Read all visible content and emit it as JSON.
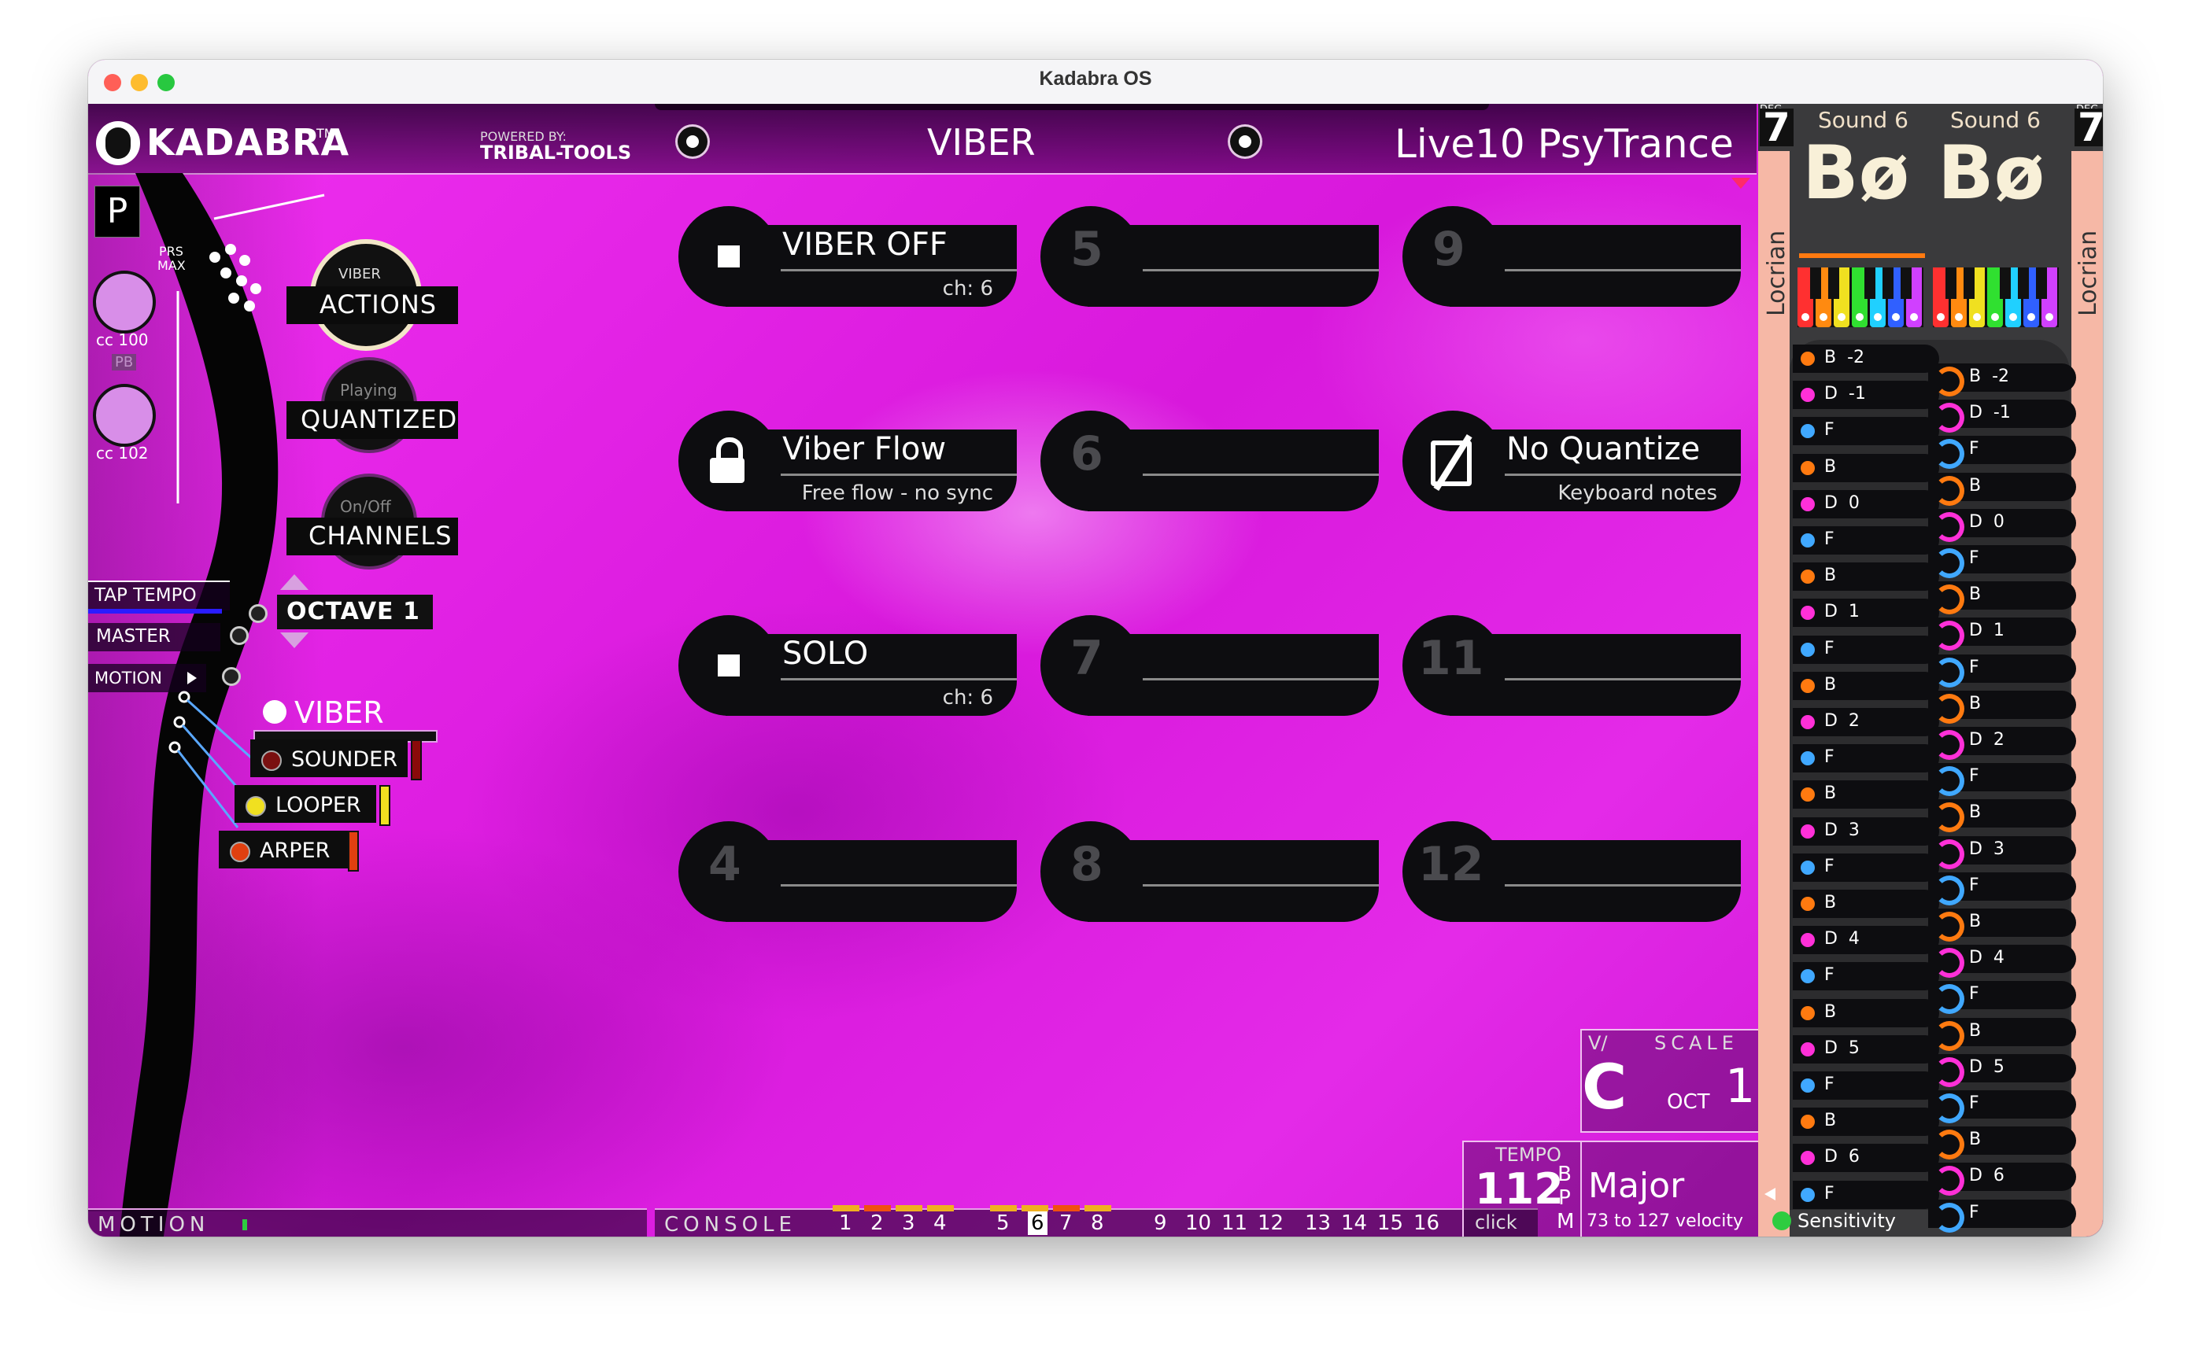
{
  "window": {
    "title": "Kadabra OS"
  },
  "header": {
    "logo": "KADABRA",
    "tm": "TM",
    "powered_by": "POWERED BY:",
    "powered_name": "TRIBAL-TOOLS",
    "mode": "VIBER",
    "preset": "Live10 PsyTrance"
  },
  "left": {
    "p_label": "P",
    "cc1": "cc 100",
    "cc2": "cc 102",
    "pb": "PB",
    "prs": "PRS",
    "max": "MAX",
    "round_buttons": [
      {
        "top": "VIBER",
        "main": "ACTIONS"
      },
      {
        "top": "Playing",
        "main": "QUANTIZED"
      },
      {
        "top": "On/Off",
        "main": "CHANNELS"
      }
    ],
    "tap_tempo": "TAP TEMPO",
    "master": "MASTER",
    "motion": "MOTION",
    "octave": "OCTAVE 1",
    "instrument": "VIBER",
    "instruments": [
      {
        "label": "SOUNDER",
        "color": "#8a0a0a"
      },
      {
        "label": "LOOPER",
        "color": "#f0e020"
      },
      {
        "label": "ARPER",
        "color": "#e04010"
      }
    ]
  },
  "grid": [
    {
      "num": "",
      "label": "VIBER OFF",
      "sub": "ch: 6",
      "icon": "stop"
    },
    {
      "num": "5",
      "label": "",
      "sub": ""
    },
    {
      "num": "9",
      "label": "",
      "sub": ""
    },
    {
      "num": "",
      "label": "Viber Flow",
      "sub": "Free flow - no sync",
      "icon": "unlock"
    },
    {
      "num": "6",
      "label": "",
      "sub": ""
    },
    {
      "num": "",
      "label": "No Quantize",
      "sub": "Keyboard notes",
      "icon": "no-quantize"
    },
    {
      "num": "",
      "label": "SOLO",
      "sub": "ch: 6",
      "icon": "stop"
    },
    {
      "num": "7",
      "label": "",
      "sub": ""
    },
    {
      "num": "11",
      "label": "",
      "sub": ""
    },
    {
      "num": "4",
      "label": "",
      "sub": ""
    },
    {
      "num": "8",
      "label": "",
      "sub": ""
    },
    {
      "num": "12",
      "label": "",
      "sub": ""
    }
  ],
  "bottom": {
    "motion": "MOTION",
    "console": "CONSOLE",
    "channels": [
      "1",
      "2",
      "3",
      "4",
      "5",
      "6",
      "7",
      "8",
      "9",
      "10",
      "11",
      "12",
      "13",
      "14",
      "15",
      "16"
    ],
    "active_channel": "6"
  },
  "scale": {
    "v": "V/",
    "title": "SCALE",
    "key": "C",
    "oct_label": "OCT",
    "oct": "1",
    "tempo_label": "TEMPO",
    "bpm": "112",
    "bpm_unit": "BPM",
    "click": "click",
    "mode": "Major",
    "velocity": "73 to 127 velocity"
  },
  "right": {
    "deg_label": "DEG",
    "deg": "7",
    "mode_name": "Locrian",
    "sound_label": "Sound 6",
    "chord": "Bø",
    "sensitivity": "Sensitivity",
    "col1": [
      "B  -2",
      "D  -1",
      "F",
      "B",
      "D  0",
      "F",
      "B",
      "D  1",
      "F",
      "B",
      "D  2",
      "F",
      "B",
      "D  3",
      "F",
      "B",
      "D  4",
      "F",
      "B",
      "D  5",
      "F",
      "B",
      "D  6",
      "F"
    ],
    "col2": [
      "B  -2",
      "D  -1",
      "F",
      "B",
      "D  0",
      "F",
      "B",
      "D  1",
      "F",
      "B",
      "D  2",
      "F",
      "B",
      "D  3",
      "F",
      "B",
      "D  4",
      "F",
      "B",
      "D  5",
      "F",
      "B",
      "D  6",
      "F"
    ],
    "colors": {
      "B": "#ff7a10",
      "D": "#ff30d8",
      "F": "#40a8ff"
    }
  }
}
